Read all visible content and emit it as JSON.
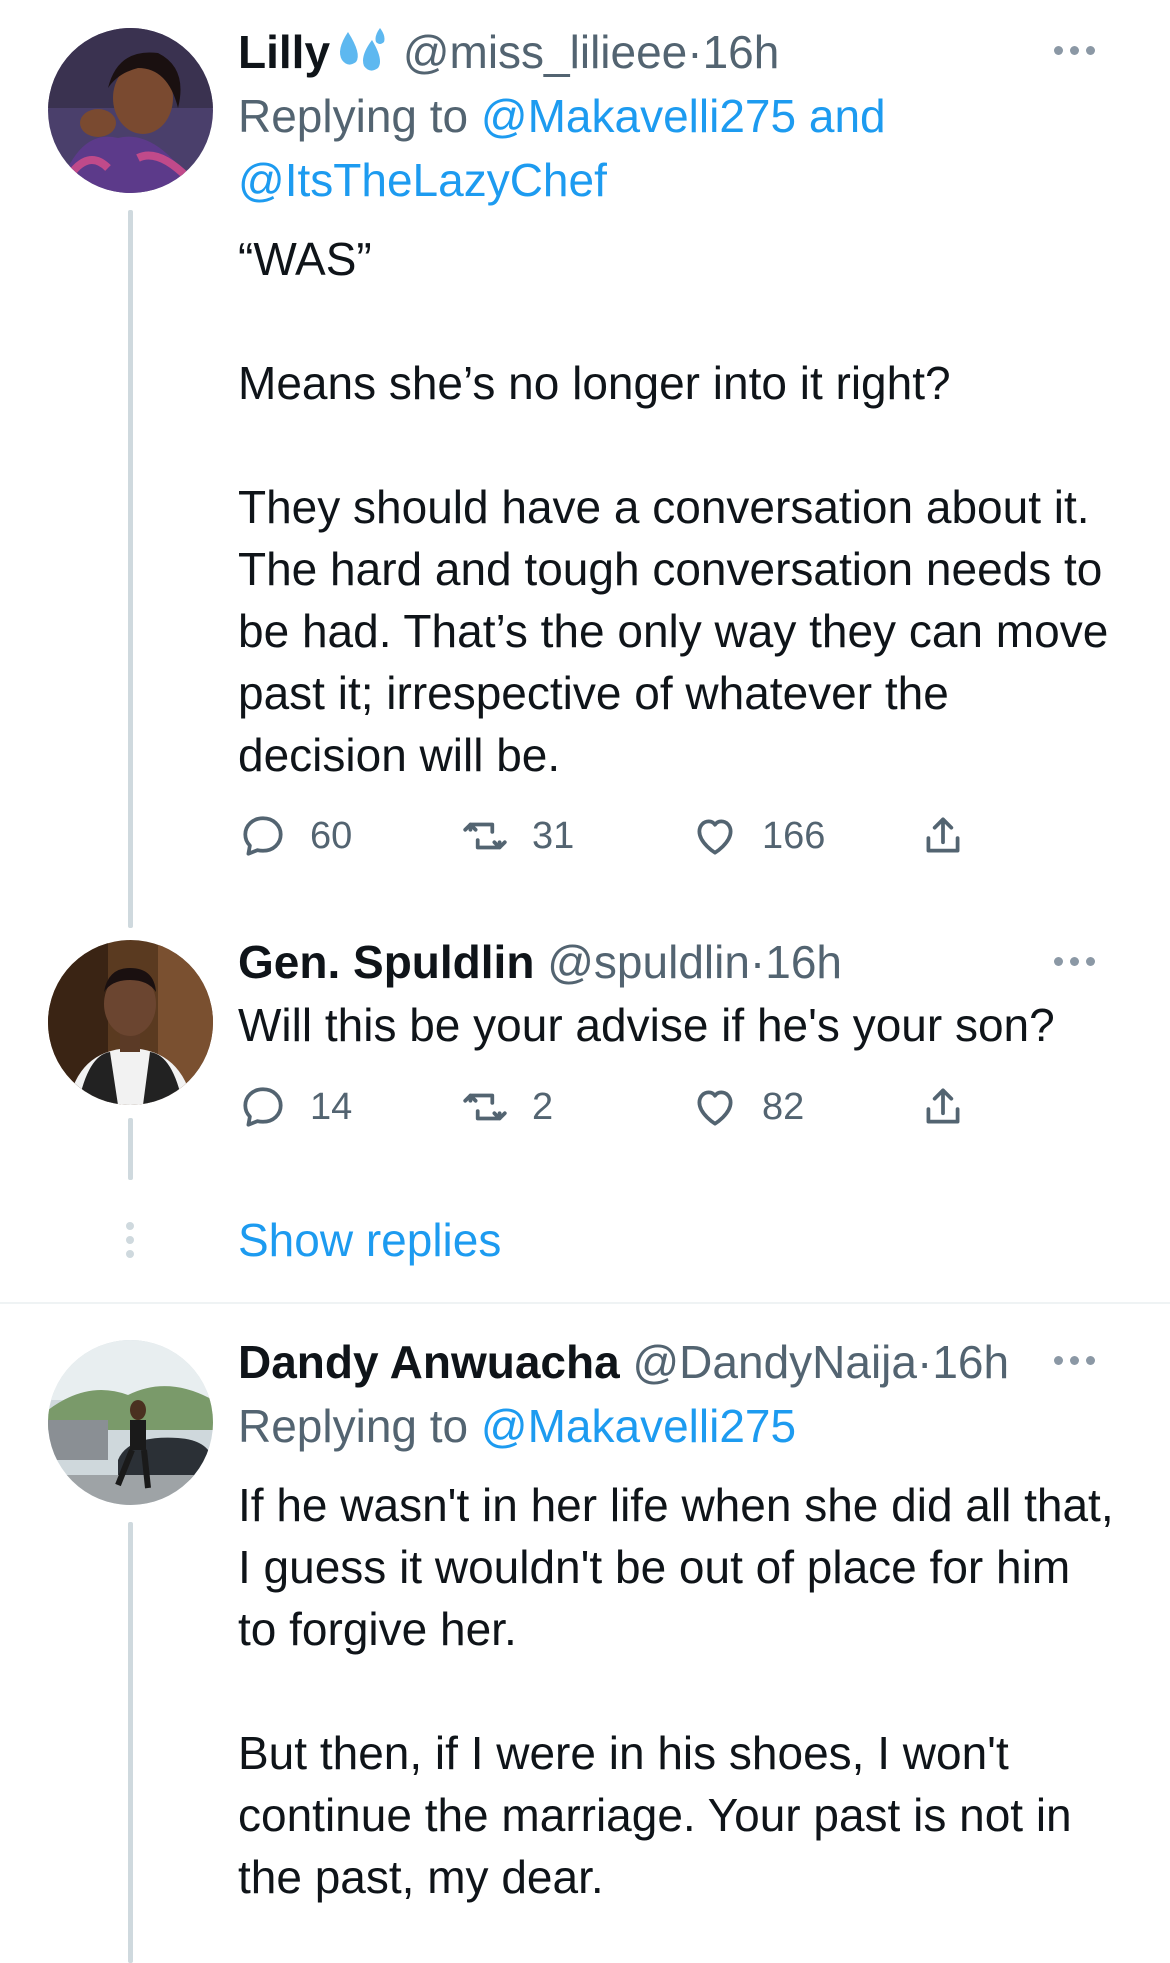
{
  "tweets": [
    {
      "name": "Lilly",
      "emoji": "sweat-droplets-icon",
      "handle": "@miss_lilieee",
      "separator": "·",
      "time": "16h",
      "replying_prefix": "Replying to ",
      "replying_mentions": "@Makavelli275 and @ItsTheLazyChef",
      "paragraphs": [
        "“WAS”",
        "Means she’s no longer into it right?",
        "They should have a conversation about it. The hard and tough conversation needs to be had. That’s the only way they can move past it; irrespective of whatever the decision will be."
      ],
      "replies": "60",
      "retweets": "31",
      "likes": "166"
    },
    {
      "name": "Gen. Spuldlin",
      "handle": "@spuldlin",
      "separator": "·",
      "time": "16h",
      "paragraphs": [
        "Will this be your advise if he's your son?"
      ],
      "replies": "14",
      "retweets": "2",
      "likes": "82"
    },
    {
      "name": "Dandy Anwuacha",
      "handle": "@DandyNaija",
      "separator": "·",
      "time": "16h",
      "replying_prefix": "Replying to ",
      "replying_mentions": "@Makavelli275",
      "paragraphs": [
        "If he wasn't in her life when she did all that, I guess it wouldn't be out of place for him to forgive her.",
        "But then, if I were in his shoes, I won't continue the marriage. Your past is not in the past, my dear."
      ]
    }
  ],
  "show_replies": "Show replies",
  "colors": {
    "accent": "#1d9bf0",
    "text": "#0f1419",
    "secondary": "#536471",
    "thread_line": "#cfd9de"
  }
}
